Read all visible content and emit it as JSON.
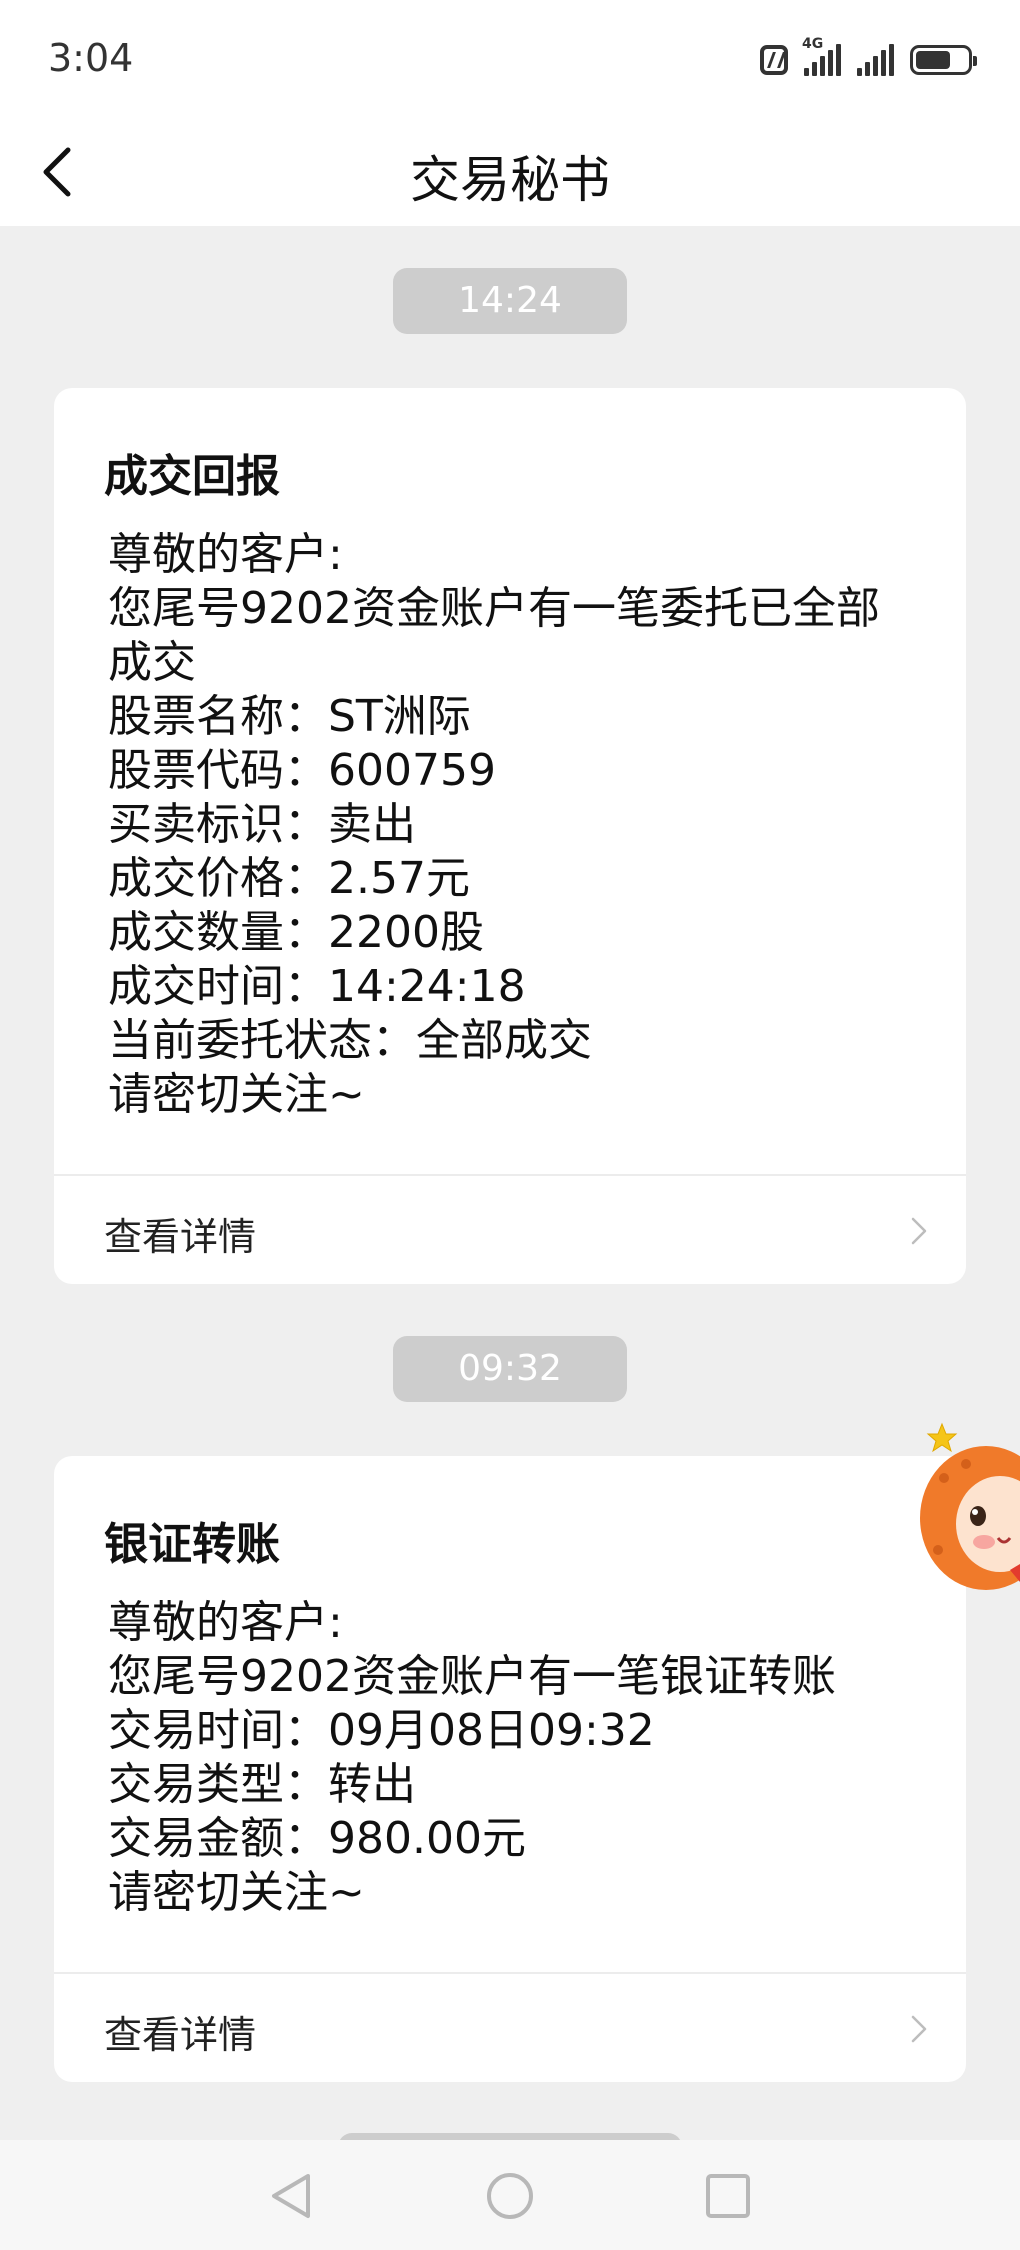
{
  "status_bar": {
    "time": "3:04",
    "network": "4G",
    "icons": [
      "nfc-icon",
      "signal-icon",
      "signal-icon",
      "battery-icon"
    ]
  },
  "header": {
    "title": "交易秘书",
    "back_icon": "chevron-left-icon"
  },
  "messages": [
    {
      "time": "14:24",
      "title": "成交回报",
      "lines": [
        "尊敬的客户:",
        "您尾号9202资金账户有一笔委托已全部",
        "成交",
        "股票名称：ST洲际",
        "股票代码：600759",
        "买卖标识：卖出",
        "成交价格：2.57元",
        "成交数量：2200股",
        "成交时间：14:24:18",
        "当前委托状态：全部成交",
        "请密切关注~"
      ],
      "details_label": "查看详情"
    },
    {
      "time": "09:32",
      "title": "银证转账",
      "lines": [
        "尊敬的客户:",
        "您尾号9202资金账户有一笔银证转账",
        "交易时间：09月08日09:32",
        "交易类型：转出",
        "交易金额：980.00元",
        "请密切关注~"
      ],
      "details_label": "查看详情"
    }
  ],
  "floating_widget": "mascot-icon",
  "system_nav": [
    "back-triangle-icon",
    "home-circle-icon",
    "recents-square-icon"
  ],
  "colors": {
    "background": "#efefef",
    "card": "#ffffff",
    "time_chip": "#cdcdcd",
    "mascot_orange": "#f07a2a"
  }
}
